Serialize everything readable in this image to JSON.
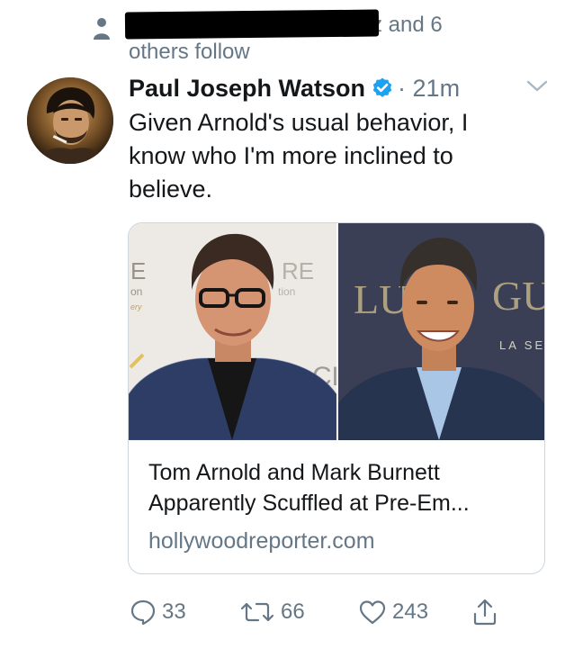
{
  "social_context": {
    "visible_fragment": "z",
    "suffix": "and 6",
    "line2": "others follow"
  },
  "tweet": {
    "author_name": "Paul Joseph Watson",
    "timestamp": "· 21m",
    "text": "Given Arnold's usual behavior, I know who I'm more inclined to believe.",
    "verified": true
  },
  "card": {
    "title": "Tom Arnold and Mark Burnett Apparently Scuffled at Pre-Em...",
    "domain": "hollywoodreporter.com",
    "image_backdrop_left_text": "RE",
    "image_backdrop_left_small": "tion",
    "image_backdrop_right_text": "GU",
    "image_backdrop_right_small": "LA SE"
  },
  "actions": {
    "replies": "33",
    "retweets": "66",
    "likes": "243"
  },
  "colors": {
    "text_primary": "#14171a",
    "text_secondary": "#657786",
    "verified_blue": "#1da1f2",
    "border": "#ccd6dd"
  },
  "icons": [
    "person-icon",
    "verified-icon",
    "chevron-down-icon",
    "reply-icon",
    "retweet-icon",
    "like-icon",
    "share-icon"
  ]
}
